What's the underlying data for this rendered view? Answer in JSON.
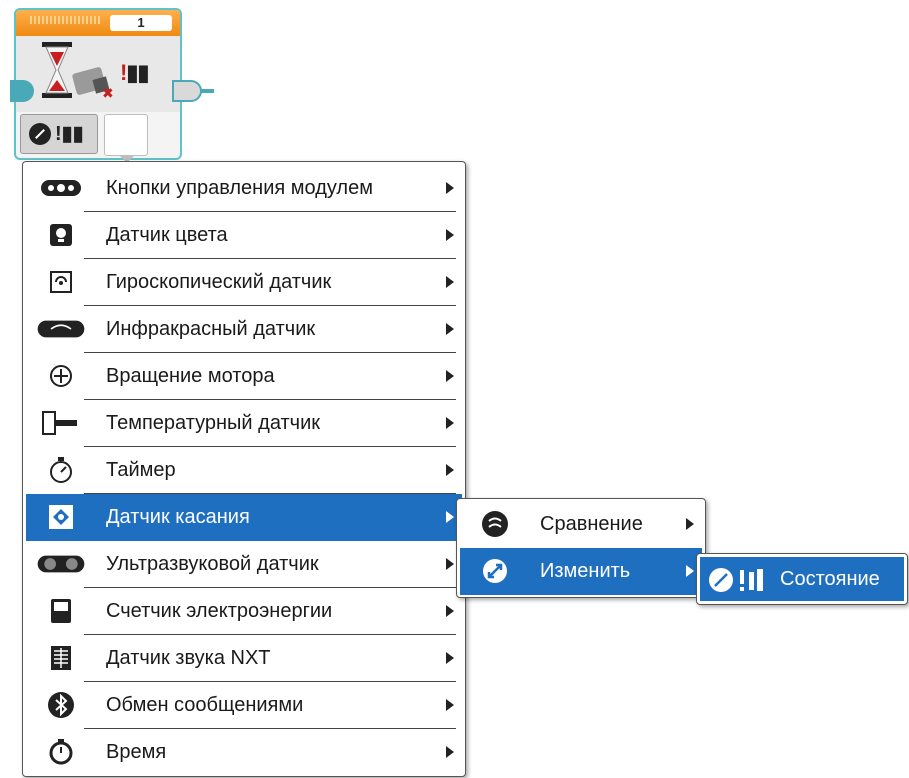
{
  "wait_block": {
    "port": "1"
  },
  "main_menu": {
    "items": [
      {
        "label": "Кнопки управления модулем",
        "icon": "brick-buttons-icon"
      },
      {
        "label": "Датчик цвета",
        "icon": "color-sensor-icon"
      },
      {
        "label": "Гироскопический датчик",
        "icon": "gyro-sensor-icon"
      },
      {
        "label": "Инфракрасный датчик",
        "icon": "infrared-sensor-icon"
      },
      {
        "label": "Вращение мотора",
        "icon": "motor-rotation-icon"
      },
      {
        "label": "Температурный датчик",
        "icon": "temperature-sensor-icon"
      },
      {
        "label": "Таймер",
        "icon": "timer-icon"
      },
      {
        "label": "Датчик касания",
        "icon": "touch-sensor-icon",
        "selected": true
      },
      {
        "label": "Ультразвуковой датчик",
        "icon": "ultrasonic-sensor-icon"
      },
      {
        "label": "Счетчик электроэнергии",
        "icon": "energy-meter-icon"
      },
      {
        "label": "Датчик звука NXT",
        "icon": "nxt-sound-sensor-icon"
      },
      {
        "label": "Обмен сообщениями",
        "icon": "bluetooth-messaging-icon"
      },
      {
        "label": "Время",
        "icon": "time-icon"
      }
    ]
  },
  "sub_menu": {
    "items": [
      {
        "label": "Сравнение",
        "icon": "compare-icon"
      },
      {
        "label": "Изменить",
        "icon": "change-icon",
        "selected": true
      }
    ]
  },
  "state_menu": {
    "items": [
      {
        "label": "Состояние",
        "icon": "state-icon",
        "selected": true
      }
    ]
  },
  "colors": {
    "selection": "#1e6fc0",
    "block_header": "#f08a12",
    "block_border": "#5ec2c9"
  }
}
